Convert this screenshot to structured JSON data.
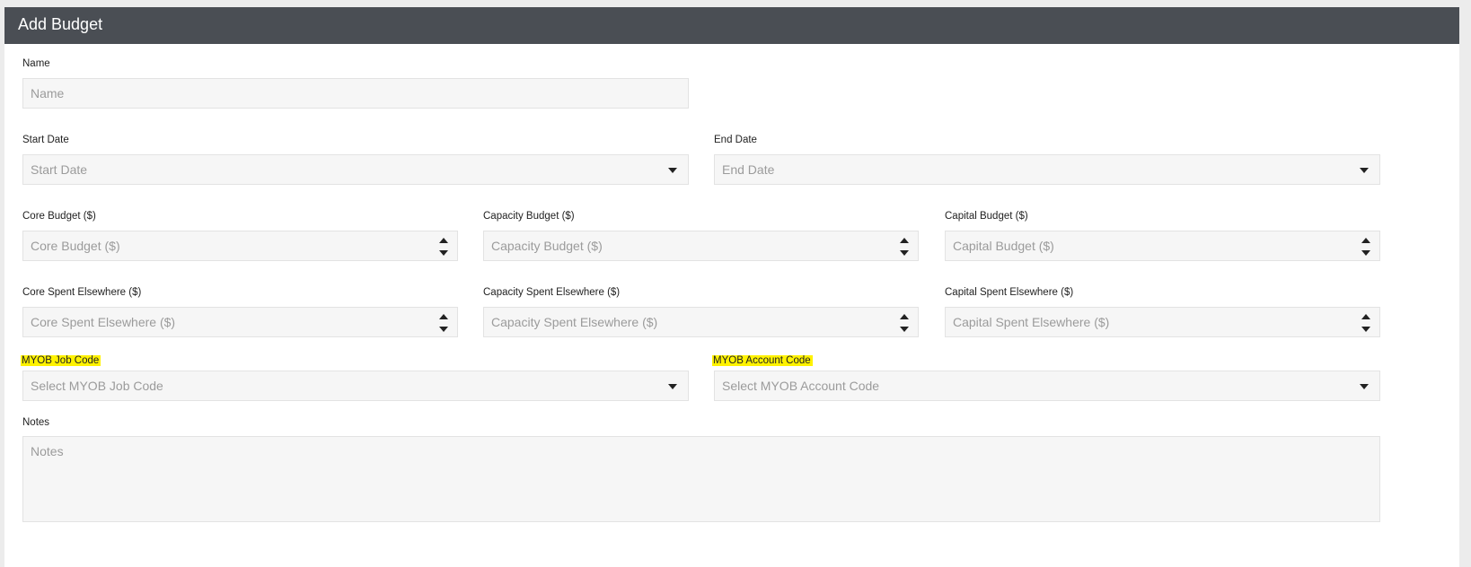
{
  "form": {
    "title": "Add Budget",
    "name": {
      "label": "Name",
      "placeholder": "Name"
    },
    "start_date": {
      "label": "Start Date",
      "placeholder": "Start Date"
    },
    "end_date": {
      "label": "End Date",
      "placeholder": "End Date"
    },
    "core_budget": {
      "label": "Core Budget ($)",
      "placeholder": "Core Budget ($)"
    },
    "capacity_budget": {
      "label": "Capacity Budget ($)",
      "placeholder": "Capacity Budget ($)"
    },
    "capital_budget": {
      "label": "Capital Budget ($)",
      "placeholder": "Capital Budget ($)"
    },
    "core_spent": {
      "label": "Core Spent Elsewhere ($)",
      "placeholder": "Core Spent Elsewhere ($)"
    },
    "capacity_spent": {
      "label": "Capacity Spent Elsewhere ($)",
      "placeholder": "Capacity Spent Elsewhere ($)"
    },
    "capital_spent": {
      "label": "Capital Spent Elsewhere ($)",
      "placeholder": "Capital Spent Elsewhere ($)"
    },
    "myob_job_code": {
      "label": "MYOB Job Code",
      "placeholder": "Select MYOB Job Code"
    },
    "myob_account_code": {
      "label": "MYOB Account Code",
      "placeholder": "Select MYOB Account Code"
    },
    "notes": {
      "label": "Notes",
      "placeholder": "Notes"
    }
  },
  "colors": {
    "header_bg": "#4a4e54",
    "highlight": "#fff200",
    "field_bg": "#f6f6f6"
  },
  "icons": {
    "dropdown": "caret-down-icon",
    "stepper": "spinner-arrows-icon"
  }
}
